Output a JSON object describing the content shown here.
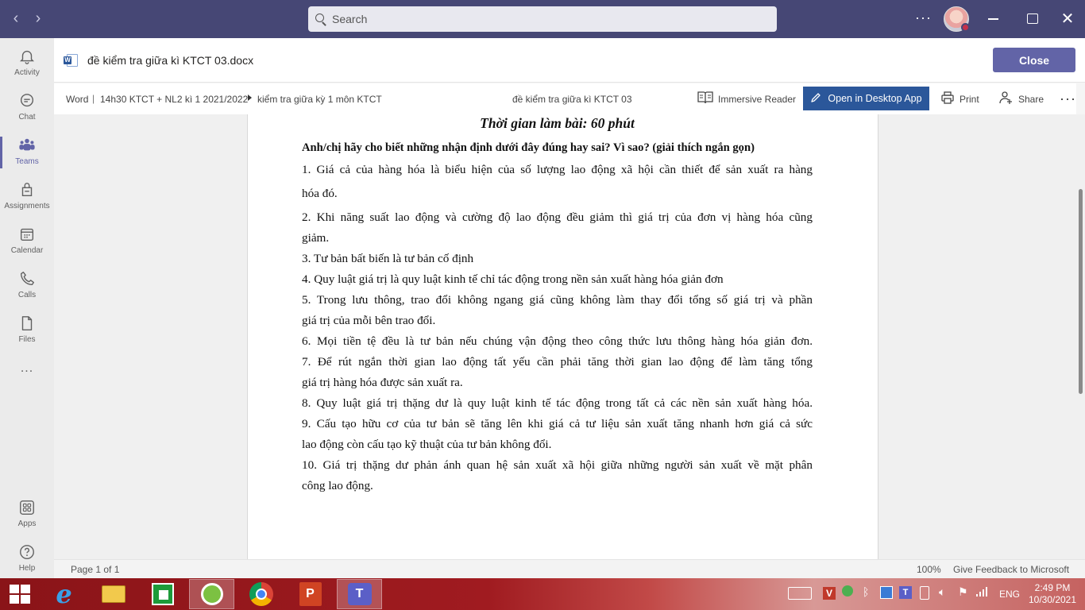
{
  "search": {
    "placeholder": "Search"
  },
  "appbar": {
    "items": [
      {
        "label": "Activity",
        "icon": "bell-icon"
      },
      {
        "label": "Chat",
        "icon": "chat-icon"
      },
      {
        "label": "Teams",
        "icon": "teams-icon"
      },
      {
        "label": "Assignments",
        "icon": "assignments-icon"
      },
      {
        "label": "Calendar",
        "icon": "calendar-icon"
      },
      {
        "label": "Calls",
        "icon": "phone-icon"
      },
      {
        "label": "Files",
        "icon": "file-icon"
      }
    ],
    "more": "...",
    "apps_label": "Apps",
    "help_label": "Help"
  },
  "header": {
    "doc_title": "đề kiểm tra giữa kì KTCT 03.docx",
    "close_label": "Close"
  },
  "wordbar": {
    "app": "Word",
    "team": "14h30 KTCT + NL2 kì 1 2021/2022",
    "channel": "kiểm tra giữa kỳ 1 môn KTCT",
    "center_title": "đề kiểm tra giữa kì KTCT 03",
    "immersive_reader": "Immersive Reader",
    "open_desktop": "Open in Desktop App",
    "print": "Print",
    "share": "Share"
  },
  "document": {
    "heading": "Thời gian làm bài: 60 phút",
    "instruction": "Anh/chị hãy cho biết những nhận định dưới đây đúng hay sai? Vì sao? (giải thích ngắn gọn)",
    "lines": [
      "1. Giá cả của hàng hóa là biểu hiện của số lượng lao động xã hội cần thiết để sản xuất ra hàng",
      "hóa đó.",
      "2. Khi năng suất lao động và cường độ lao động đều giảm thì giá trị của đơn vị hàng hóa cũng",
      "giảm.",
      "3. Tư bản bất biến là tư bản cố định",
      "4. Quy luật giá trị là quy luật kinh tế chỉ tác động trong nền sản xuất hàng hóa giản đơn",
      "5. Trong lưu thông, trao đổi không ngang giá cũng không làm thay đổi tổng số giá trị và phần",
      "giá trị của mỗi bên trao đổi.",
      "6. Mọi tiền tệ đều là tư bản nếu chúng vận động theo công thức lưu thông hàng hóa giản đơn.",
      "7. Để rút ngắn thời gian lao động tất yếu cần phải tăng thời gian lao động để làm tăng tổng",
      "giá trị hàng hóa được sản xuất ra.",
      "8. Quy luật giá trị thặng dư là quy luật kinh tế tác động trong tất cả các nền sản xuất hàng hóa.",
      "9. Cấu tạo hữu cơ của tư bản sẽ tăng lên khi giá cả tư liệu sản xuất tăng nhanh hơn giá cả sức",
      "lao động còn cấu tạo kỹ thuật của tư bản không đổi.",
      "10. Giá trị thặng dư phản ánh quan hệ sản xuất xã hội giữa những người sản xuất về mặt phân",
      "công lao động."
    ]
  },
  "status": {
    "page": "Page 1 of 1",
    "zoom": "100%",
    "feedback": "Give Feedback to Microsoft"
  },
  "taskbar": {
    "language": "ENG",
    "time": "2:49 PM",
    "date": "10/30/2021"
  },
  "colors": {
    "titlebar": "#464775",
    "accent": "#6264a7",
    "word_blue": "#2b579a"
  }
}
